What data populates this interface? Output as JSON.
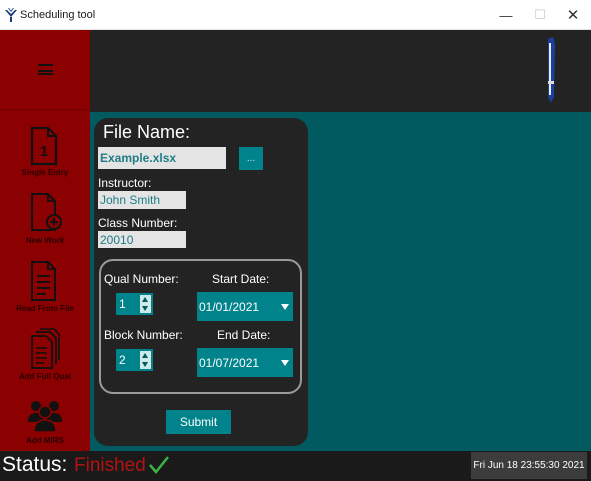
{
  "window": {
    "title": "Scheduling tool",
    "min_glyph": "—",
    "max_glyph": "☐",
    "close_glyph": "✕"
  },
  "sidebar": {
    "items": [
      {
        "label": "Single Entry",
        "icon": "single-entry-icon"
      },
      {
        "label": "New Work",
        "icon": "new-work-icon"
      },
      {
        "label": "Read From File",
        "icon": "read-from-file-icon"
      },
      {
        "label": "Add Full Qual",
        "icon": "add-full-qual-icon"
      },
      {
        "label": "Add MIRS",
        "icon": "add-mirs-icon"
      }
    ],
    "single_entry_number": "1"
  },
  "form": {
    "file_name_label": "File Name:",
    "file_name_value": "Example.xlsx",
    "browse_label": "...",
    "instructor_label": "Instructor:",
    "instructor_value": "John Smith",
    "class_number_label": "Class Number:",
    "class_number_value": "20010",
    "qual_number_label": "Qual Number:",
    "qual_number_value": "1",
    "start_date_label": "Start Date:",
    "start_date_value": "01/01/2021",
    "block_number_label": "Block Number:",
    "block_number_value": "2",
    "end_date_label": "End Date:",
    "end_date_value": "01/07/2021",
    "submit_label": "Submit"
  },
  "status": {
    "label": "Status:",
    "value": "Finished",
    "datetime": "Fri Jun 18 23:55:30 2021"
  },
  "colors": {
    "sidebar": "#8b0000",
    "header": "#232323",
    "main": "#005a60",
    "accent": "#00838a",
    "status_finished": "#b31212",
    "check": "#3cb043"
  }
}
